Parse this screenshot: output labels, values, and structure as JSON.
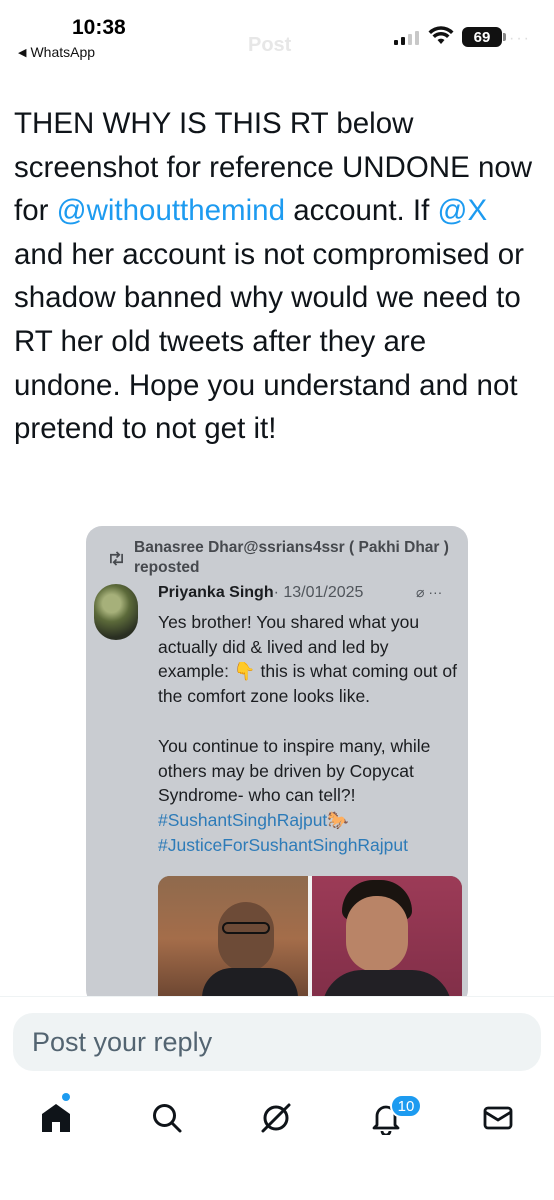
{
  "status_bar": {
    "time": "10:38",
    "back_app": "WhatsApp",
    "ghost_title": "Post",
    "battery": "69"
  },
  "post": {
    "text_segments": [
      {
        "text": "THEN WHY IS THIS RT below screenshot for reference UNDONE now for ",
        "link": false
      },
      {
        "text": "@withoutthemind",
        "link": true
      },
      {
        "text": " account. If ",
        "link": false
      },
      {
        "text": "@X",
        "link": true
      },
      {
        "text": " and her account is not compromised or shadow banned why would we need to RT her old tweets after they are undone. Hope you understand and not pretend to not get it!",
        "link": false
      }
    ]
  },
  "embedded_tweet": {
    "repost_line": "Banasree Dhar@ssrians4ssr ( Pakhi Dhar ) reposted",
    "author": "Priyanka Singh",
    "date": "· 13/01/2025",
    "paragraph1": "Yes brother! You shared what you actually did & lived and led by example: 👇 this is what coming out of the comfort zone looks like.",
    "paragraph2": "You continue to inspire many, while others may be driven by Copycat Syndrome- who can tell?!",
    "hashtag1": "#SushantSinghRajput🐎",
    "hashtag2": "#JusticeForSushantSinghRajput"
  },
  "reply": {
    "placeholder": "Post your reply"
  },
  "nav": {
    "items": [
      {
        "icon": "home-icon"
      },
      {
        "icon": "search-icon"
      },
      {
        "icon": "grok-icon"
      },
      {
        "icon": "bell-icon"
      },
      {
        "icon": "mail-icon"
      }
    ],
    "notification_count": "10"
  },
  "colors": {
    "link": "#1d9bf0",
    "text": "#0f1419",
    "reply_bg": "#eff3f4"
  }
}
